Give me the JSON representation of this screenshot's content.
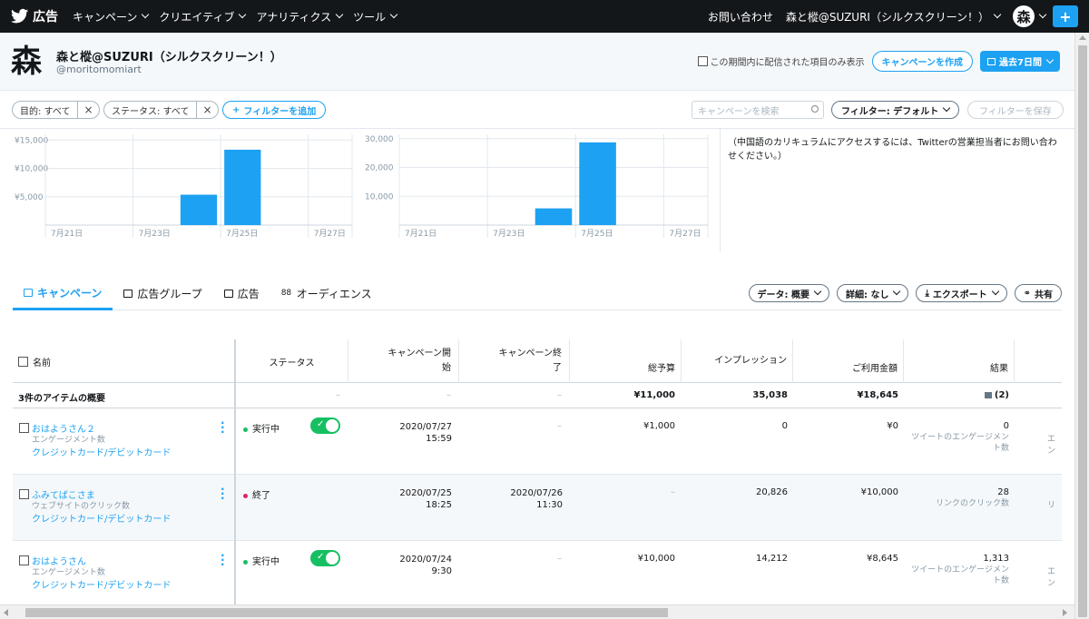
{
  "nav": {
    "brand": "広告",
    "items": [
      "キャンペーン",
      "クリエイティブ",
      "アナリティクス",
      "ツール"
    ],
    "contact": "お問い合わせ",
    "account": "森と樅@SUZURI（シルクスクリーン！）",
    "avatar_glyph": "森"
  },
  "header": {
    "avatar_glyph": "森",
    "name": "森と樅@SUZURI（シルクスクリーン！）",
    "handle": "@moritomomiart",
    "only_delivered_label": "この期間内に配信された項目のみ表示",
    "create_campaign": "キャンペーンを作成",
    "date_range": "過去7日間"
  },
  "filters": {
    "objective": "目的: すべて",
    "status": "ステータス: すべて",
    "add_filter": "フィルターを追加",
    "search_placeholder": "キャンペーンを検索",
    "filter_default": "フィルター: デフォルト",
    "save_filter": "フィルターを保存"
  },
  "chart_data": [
    {
      "type": "bar",
      "categories": [
        "7月21日",
        "7月22日",
        "7月23日",
        "7月24日",
        "7月25日",
        "7月26日",
        "7月27日"
      ],
      "values": [
        0,
        0,
        0,
        5355,
        13290,
        0,
        0
      ],
      "xticks": [
        "7月21日",
        "7月23日",
        "7月25日",
        "7月27日"
      ],
      "yticks": [
        "¥5,000",
        "¥10,000",
        "¥15,000"
      ],
      "ylim": [
        0,
        16000
      ],
      "color": "#1da1f2"
    },
    {
      "type": "bar",
      "categories": [
        "7月21日",
        "7月22日",
        "7月23日",
        "7月24日",
        "7月25日",
        "7月26日",
        "7月27日"
      ],
      "values": [
        0,
        0,
        0,
        5800,
        28700,
        0,
        0
      ],
      "xticks": [
        "7月21日",
        "7月23日",
        "7月25日",
        "7月27日"
      ],
      "yticks": [
        "10,000",
        "20,000",
        "30,000"
      ],
      "ylim": [
        0,
        31500
      ],
      "color": "#1da1f2"
    }
  ],
  "notice": "（中国語のカリキュラムにアクセスするには、Twitterの営業担当者にお問い合わせください。）",
  "tabs": [
    "キャンペーン",
    "広告グループ",
    "広告",
    "オーディエンス"
  ],
  "tab_buttons": {
    "data": "データ: 概要",
    "details": "詳細: なし",
    "export": "エクスポート",
    "share": "共有"
  },
  "table": {
    "headers": {
      "name": "名前",
      "status": "ステータス",
      "start": "キャンペーン開始",
      "end": "キャンペーン終了",
      "budget": "総予算",
      "impressions": "インプレッション",
      "spend": "ご利用金額",
      "results": "結果"
    },
    "summary": {
      "label": "3件のアイテムの概要",
      "status": "–",
      "start": "–",
      "end": "–",
      "budget": "¥11,000",
      "impressions": "35,038",
      "spend": "¥18,645",
      "results": "(2)"
    },
    "rows": [
      {
        "name": "おはようさん２",
        "objective": "エンゲージメント数",
        "payment": "クレジットカード/デビットカード",
        "status": "実行中",
        "status_color": "#17bf63",
        "toggle": true,
        "start_date": "2020/07/27",
        "start_time": "15:59",
        "end": "–",
        "budget": "¥1,000",
        "impressions": "0",
        "spend": "¥0",
        "results": "0",
        "results_type_1": "ツイートのエンゲージメン",
        "results_type_2": "ト数",
        "overflow": "エン"
      },
      {
        "name": "ふみてぱこさま",
        "objective": "ウェブサイトのクリック数",
        "payment": "クレジットカード/デビットカード",
        "status": "終了",
        "status_color": "#e0245e",
        "toggle": false,
        "start_date": "2020/07/25",
        "start_time": "18:25",
        "end_date": "2020/07/26",
        "end_time": "11:30",
        "budget": "–",
        "impressions": "20,826",
        "spend": "¥10,000",
        "results": "28",
        "results_type_1": "リンクのクリック数",
        "results_type_2": "",
        "overflow": "リ"
      },
      {
        "name": "おはようさん",
        "objective": "エンゲージメント数",
        "payment": "クレジットカード/デビットカード",
        "status": "実行中",
        "status_color": "#17bf63",
        "toggle": true,
        "start_date": "2020/07/24",
        "start_time": "9:30",
        "end": "–",
        "budget": "¥10,000",
        "impressions": "14,212",
        "spend": "¥8,645",
        "results": "1,313",
        "results_type_1": "ツイートのエンゲージメン",
        "results_type_2": "ト数",
        "overflow": "エン"
      }
    ]
  }
}
